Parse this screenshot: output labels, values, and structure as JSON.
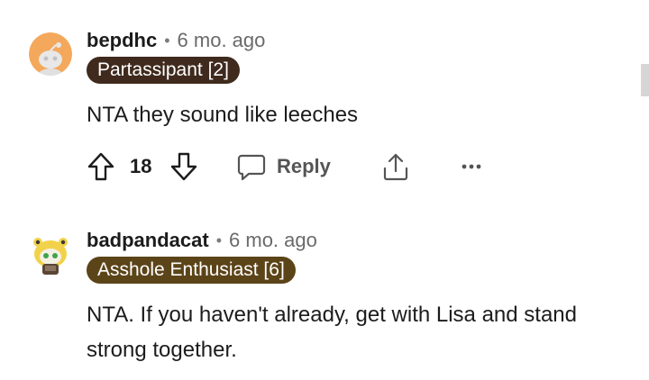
{
  "comments": [
    {
      "username": "bepdhc",
      "separator": "•",
      "time": "6 mo. ago",
      "flair": "Partassipant [2]",
      "body": "NTA they sound like leeches",
      "score": "18",
      "reply_label": "Reply"
    },
    {
      "username": "badpandacat",
      "separator": "•",
      "time": "6 mo. ago",
      "flair": "Asshole Enthusiast [6]",
      "body": "NTA. If you haven't already, get with Lisa and stand strong together."
    }
  ],
  "icons": {
    "upvote": "upvote-arrow-icon",
    "downvote": "downvote-arrow-icon",
    "reply": "speech-bubble-icon",
    "share": "share-icon",
    "more": "ellipsis-icon"
  },
  "colors": {
    "flair_1": "#3f2a1d",
    "flair_2": "#5c4419",
    "avatar_1": "#f4a85c"
  }
}
